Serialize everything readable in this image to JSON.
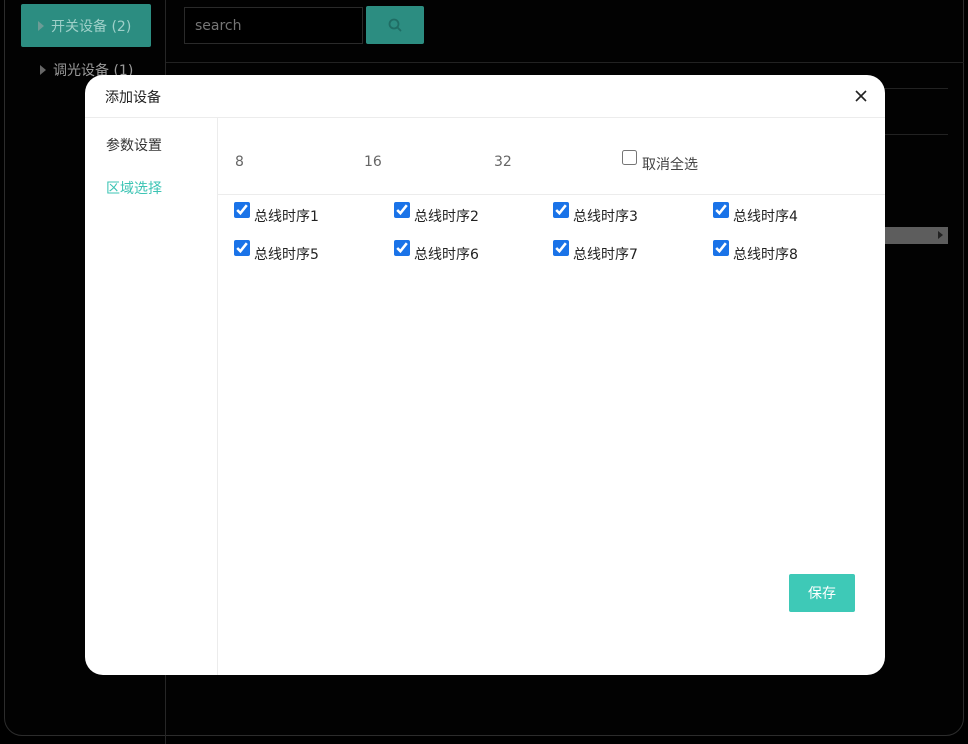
{
  "background": {
    "sidebar": [
      {
        "label": "开关设备 (2)"
      },
      {
        "label": "调光设备 (1)"
      }
    ],
    "search": {
      "placeholder": "search"
    }
  },
  "modal": {
    "title": "添加设备",
    "menu": [
      {
        "label": "参数设置",
        "active": false
      },
      {
        "label": "区域选择",
        "active": true
      }
    ],
    "options": [
      "8",
      "16",
      "32"
    ],
    "uncheck_all": {
      "label": "取消全选",
      "checked": false
    },
    "checkboxes": [
      {
        "label": "总线时序1",
        "checked": true
      },
      {
        "label": "总线时序2",
        "checked": true
      },
      {
        "label": "总线时序3",
        "checked": true
      },
      {
        "label": "总线时序4",
        "checked": true
      },
      {
        "label": "总线时序5",
        "checked": true
      },
      {
        "label": "总线时序6",
        "checked": true
      },
      {
        "label": "总线时序7",
        "checked": true
      },
      {
        "label": "总线时序8",
        "checked": true
      }
    ],
    "save_label": "保存"
  },
  "colors": {
    "accent": "#3ec9b7",
    "checkbox": "#1a73e8"
  },
  "icons": [
    "caret-right-icon",
    "search-icon",
    "close-icon"
  ]
}
